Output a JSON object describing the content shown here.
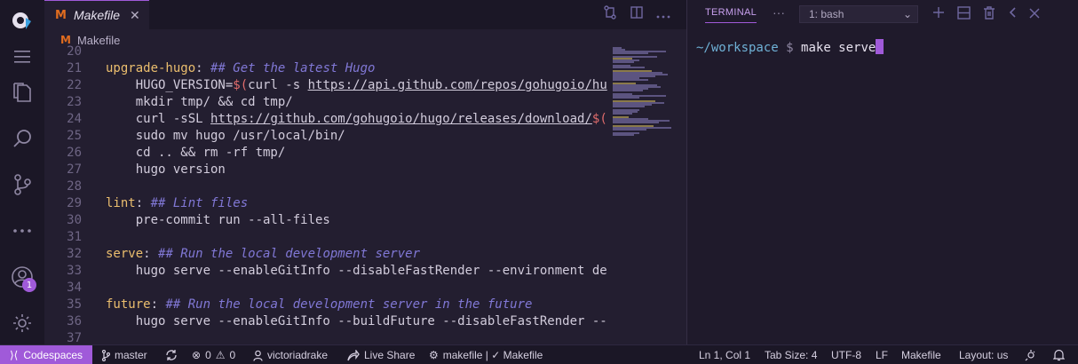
{
  "activity_bar": {
    "icons": [
      "codespaces-logo-icon",
      "menu-icon",
      "explorer-icon",
      "search-icon",
      "source-control-icon",
      "more-icon",
      "accounts-icon",
      "settings-icon"
    ],
    "accounts_badge": "1"
  },
  "editor": {
    "tab": {
      "label": "Makefile",
      "icon": "M"
    },
    "breadcrumb": "Makefile",
    "lines": [
      {
        "n": "20",
        "segs": []
      },
      {
        "n": "21",
        "segs": [
          {
            "t": "upgrade-hugo",
            "c": "k-target"
          },
          {
            "t": ": ",
            "c": "k-var"
          },
          {
            "t": "## Get the latest Hugo",
            "c": "k-comment"
          }
        ]
      },
      {
        "n": "22",
        "segs": [
          {
            "t": "    HUGO_VERSION=",
            "c": "k-var"
          },
          {
            "t": "$(",
            "c": "k-op"
          },
          {
            "t": "curl -s ",
            "c": "k-var"
          },
          {
            "t": "https://api.github.com/repos/gohugoio/hu",
            "c": "k-url"
          }
        ]
      },
      {
        "n": "23",
        "segs": [
          {
            "t": "    mkdir tmp/ && cd tmp/",
            "c": "k-var"
          }
        ]
      },
      {
        "n": "24",
        "segs": [
          {
            "t": "    curl -sSL ",
            "c": "k-var"
          },
          {
            "t": "https://github.com/gohugoio/hugo/releases/download/",
            "c": "k-url"
          },
          {
            "t": "$(",
            "c": "k-op"
          }
        ]
      },
      {
        "n": "25",
        "segs": [
          {
            "t": "    sudo mv hugo /usr/local/bin/",
            "c": "k-var"
          }
        ]
      },
      {
        "n": "26",
        "segs": [
          {
            "t": "    cd .. && rm -rf tmp/",
            "c": "k-var"
          }
        ]
      },
      {
        "n": "27",
        "segs": [
          {
            "t": "    hugo version",
            "c": "k-var"
          }
        ]
      },
      {
        "n": "28",
        "segs": []
      },
      {
        "n": "29",
        "segs": [
          {
            "t": "lint",
            "c": "k-target"
          },
          {
            "t": ": ",
            "c": "k-var"
          },
          {
            "t": "## Lint files",
            "c": "k-comment"
          }
        ]
      },
      {
        "n": "30",
        "segs": [
          {
            "t": "    pre-commit run --all-files",
            "c": "k-var"
          }
        ]
      },
      {
        "n": "31",
        "segs": []
      },
      {
        "n": "32",
        "segs": [
          {
            "t": "serve",
            "c": "k-target"
          },
          {
            "t": ": ",
            "c": "k-var"
          },
          {
            "t": "## Run the local development server",
            "c": "k-comment"
          }
        ]
      },
      {
        "n": "33",
        "segs": [
          {
            "t": "    hugo serve --enableGitInfo --disableFastRender --environment de",
            "c": "k-var"
          }
        ]
      },
      {
        "n": "34",
        "segs": []
      },
      {
        "n": "35",
        "segs": [
          {
            "t": "future",
            "c": "k-target"
          },
          {
            "t": ": ",
            "c": "k-var"
          },
          {
            "t": "## Run the local development server in the future",
            "c": "k-comment"
          }
        ]
      },
      {
        "n": "36",
        "segs": [
          {
            "t": "    hugo serve --enableGitInfo --buildFuture --disableFastRender --",
            "c": "k-var"
          }
        ]
      },
      {
        "n": "37",
        "segs": []
      }
    ],
    "actions": [
      "open-changes-icon",
      "split-editor-icon",
      "more-actions-icon"
    ]
  },
  "terminal": {
    "title": "TERMINAL",
    "selected_shell": "1: bash",
    "prompt_path": "~/workspace",
    "prompt_symbol": "$",
    "command": "make serve",
    "actions": [
      "new-terminal-icon",
      "split-terminal-icon",
      "kill-terminal-icon",
      "maximize-panel-icon",
      "close-panel-icon"
    ]
  },
  "status_bar": {
    "remote": "Codespaces",
    "branch": "master",
    "errors": "0",
    "warnings": "0",
    "user": "victoriadrake",
    "live_share": "Live Share",
    "task": "makefile | ✓ Makefile",
    "cursor_position": "Ln 1, Col 1",
    "tab_size": "Tab Size: 4",
    "encoding": "UTF-8",
    "eol": "LF",
    "language": "Makefile",
    "layout": "Layout: us"
  },
  "colors": {
    "accent": "#a05ad9",
    "background": "#231e30",
    "target": "#ebbe6e",
    "comment": "#8178d6"
  }
}
